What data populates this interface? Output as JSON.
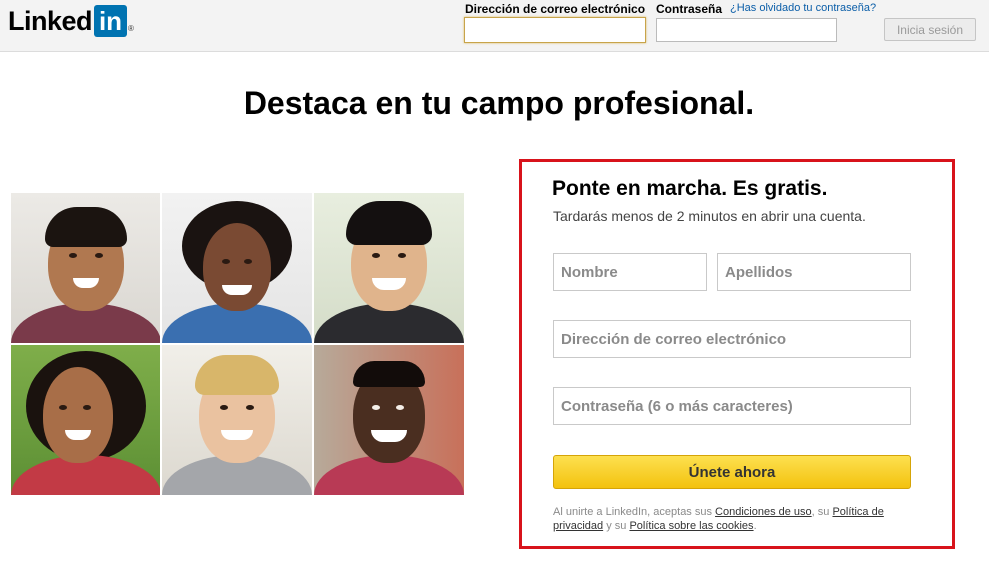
{
  "header": {
    "logo_text": "Linked",
    "logo_box": "in",
    "logo_reg": "®",
    "email_label": "Dirección de correo electrónico",
    "password_label": "Contraseña",
    "forgot_link": "¿Has olvidado tu contraseña?",
    "login_button": "Inicia sesión"
  },
  "main": {
    "headline": "Destaca en tu campo profesional."
  },
  "signup": {
    "title": "Ponte en marcha. Es gratis.",
    "subtitle": "Tardarás menos de 2 minutos en abrir una cuenta.",
    "first_name_placeholder": "Nombre",
    "last_name_placeholder": "Apellidos",
    "email_placeholder": "Dirección de correo electrónico",
    "password_placeholder": "Contraseña (6 o más caracteres)",
    "join_button": "Únete ahora",
    "terms": {
      "part1": "Al unirte a LinkedIn, aceptas sus ",
      "link1": "Condiciones de uso",
      "part2": ", su ",
      "link2": "Política de privacidad",
      "part3": " y su ",
      "link3": "Política sobre las cookies",
      "part4": "."
    }
  },
  "colors": {
    "brand_blue": "#0073b1",
    "signup_border": "#d8131b",
    "join_button": "#f6c915"
  }
}
